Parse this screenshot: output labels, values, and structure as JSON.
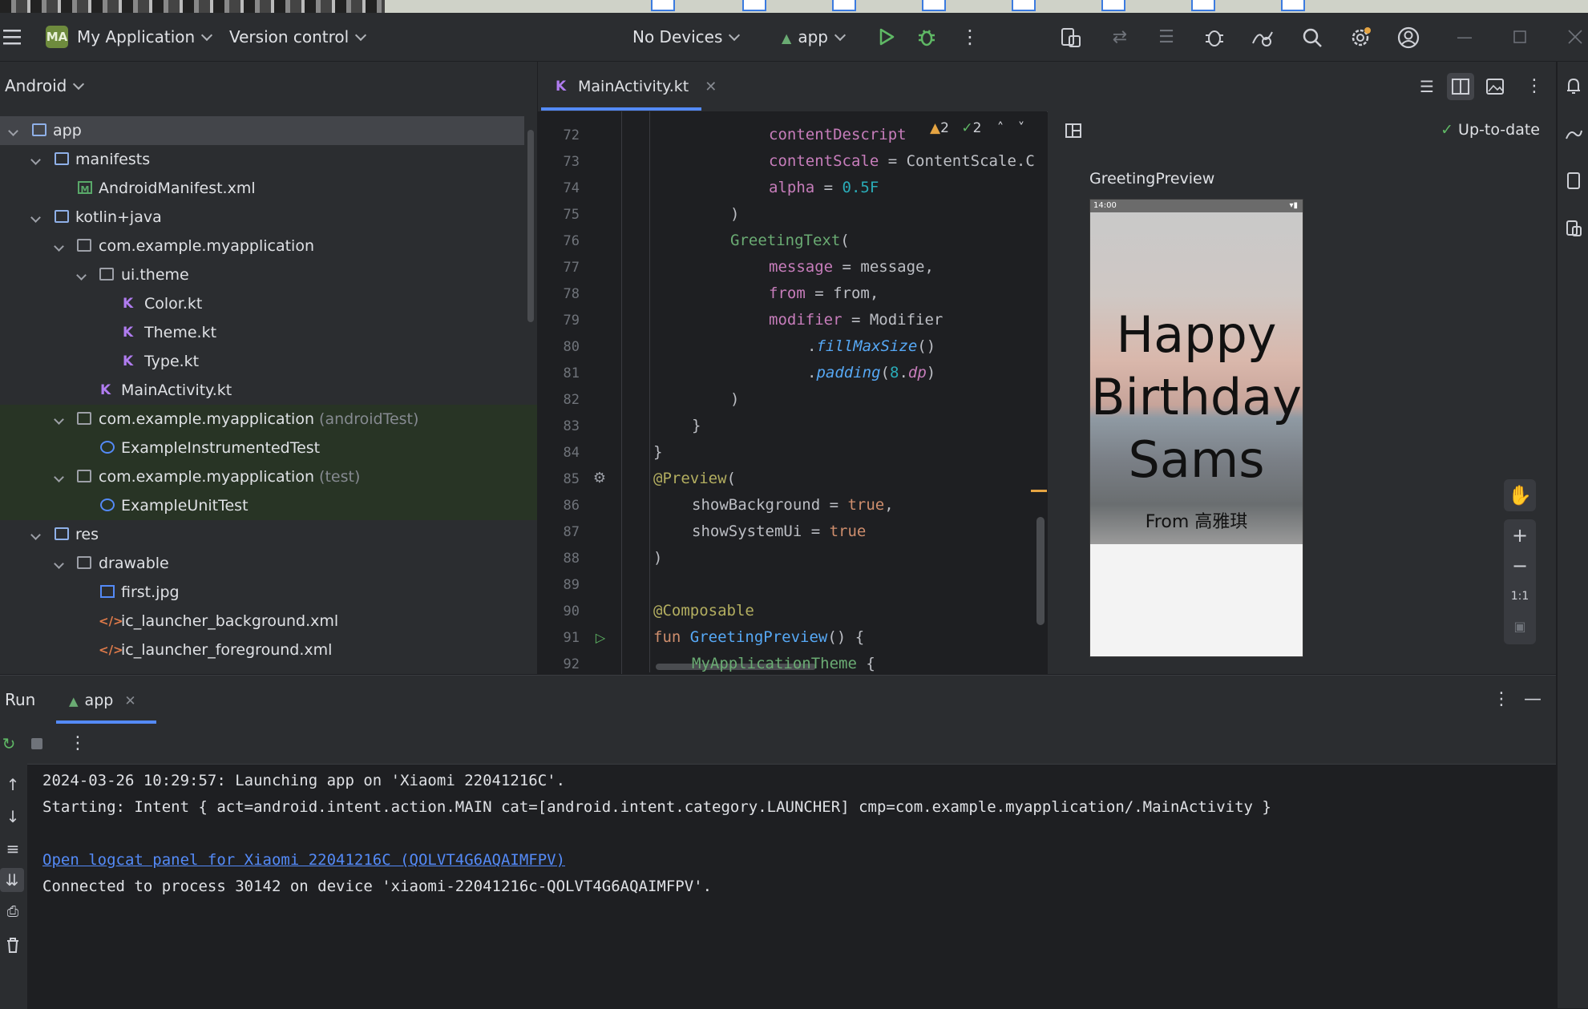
{
  "toolbar": {
    "project_badge": "MA",
    "project_name": "My Application",
    "vcs": "Version control",
    "devices": "No Devices",
    "run_config": "app"
  },
  "project_panel": {
    "view_mode": "Android",
    "tree": [
      {
        "label": "app",
        "suffix": ""
      },
      {
        "label": "manifests",
        "suffix": ""
      },
      {
        "label": "AndroidManifest.xml",
        "suffix": ""
      },
      {
        "label": "kotlin+java",
        "suffix": ""
      },
      {
        "label": "com.example.myapplication",
        "suffix": ""
      },
      {
        "label": "ui.theme",
        "suffix": ""
      },
      {
        "label": "Color.kt",
        "suffix": ""
      },
      {
        "label": "Theme.kt",
        "suffix": ""
      },
      {
        "label": "Type.kt",
        "suffix": ""
      },
      {
        "label": "MainActivity.kt",
        "suffix": ""
      },
      {
        "label": "com.example.myapplication",
        "suffix": "(androidTest)"
      },
      {
        "label": "ExampleInstrumentedTest",
        "suffix": ""
      },
      {
        "label": "com.example.myapplication",
        "suffix": "(test)"
      },
      {
        "label": "ExampleUnitTest",
        "suffix": ""
      },
      {
        "label": "res",
        "suffix": ""
      },
      {
        "label": "drawable",
        "suffix": ""
      },
      {
        "label": "first.jpg",
        "suffix": ""
      },
      {
        "label": "ic_launcher_background.xml",
        "suffix": ""
      },
      {
        "label": "ic_launcher_foreground.xml",
        "suffix": ""
      }
    ]
  },
  "editor": {
    "tab_label": "MainActivity.kt",
    "warnings": "2",
    "checks": "2",
    "line_numbers": [
      "72",
      "73",
      "74",
      "75",
      "76",
      "77",
      "78",
      "79",
      "80",
      "81",
      "82",
      "83",
      "84",
      "85",
      "86",
      "87",
      "88",
      "89",
      "90",
      "91",
      "92"
    ],
    "lines": {
      "l72_name": "contentDescript",
      "l73_name": "contentScale",
      "l73_val": "ContentScale.C",
      "l74_name": "alpha",
      "l74_val": "0.5F",
      "l75": ")",
      "l76_fn": "GreetingText",
      "l77_name": "message",
      "l77_val": "message,",
      "l78_name": "from",
      "l78_val": "from,",
      "l79_name": "modifier",
      "l79_val": "Modifier",
      "l80_fn": "fillMaxSize",
      "l81_fn": "padding",
      "l81_num": "8",
      "l81_dp": "dp",
      "l82": ")",
      "l83": "}",
      "l84": "}",
      "l85_ann": "@Preview",
      "l86_name": "showBackground",
      "l86_val": "true",
      "l87_name": "showSystemUi",
      "l87_val": "true",
      "l88": ")",
      "l90_ann": "@Composable",
      "l91_kw": "fun",
      "l91_fn": "GreetingPreview",
      "l92_fn": "MyApplicationTheme"
    }
  },
  "preview": {
    "status": "Up-to-date",
    "title": "GreetingPreview",
    "phone_time": "14:00",
    "greeting": "Happy Birthday Sams",
    "from": "From 高雅琪",
    "zoom_reset": "1:1"
  },
  "run_panel": {
    "title": "Run",
    "tab": "app",
    "console": [
      "2024-03-26 10:29:57: Launching app on 'Xiaomi 22041216C'.",
      "Starting: Intent { act=android.intent.action.MAIN cat=[android.intent.category.LAUNCHER] cmp=com.example.myapplication/.MainActivity }",
      "Open logcat panel for Xiaomi 22041216C (QOLVT4G6AQAIMFPV)",
      "Connected to process 30142 on device 'xiaomi-22041216c-QOLVT4G6AQAIMFPV'."
    ]
  },
  "colors": {
    "accent": "#548af7",
    "editor_bg": "#1e1f22",
    "panel_bg": "#2b2d30",
    "test_row_bg": "#283425"
  }
}
